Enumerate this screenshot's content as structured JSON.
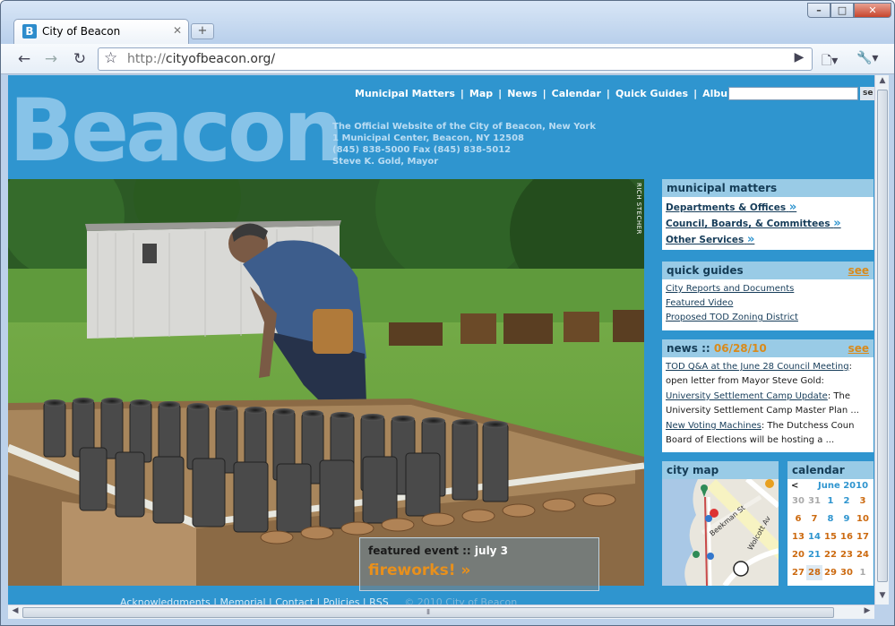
{
  "browser": {
    "tab_title": "City of Beacon",
    "tab_favicon": "B",
    "url_protocol": "http://",
    "url_host": "cityofbeacon.org/"
  },
  "site": {
    "nav": [
      "Municipal Matters",
      "Map",
      "News",
      "Calendar",
      "Quick Guides",
      "Albums"
    ],
    "search_button": "se",
    "logo": "Beacon",
    "tagline": [
      "The Official Website of the City of Beacon, New York",
      "1 Municipal Center, Beacon, NY 12508",
      "(845) 838-5000 Fax (845) 838-5012",
      "Steve K. Gold, Mayor"
    ],
    "photo_credit": "RICH STECHER"
  },
  "featured": {
    "label": "featured event ::",
    "date": "july 3",
    "event": "fireworks! »"
  },
  "municipal_matters": {
    "title": "municipal matters",
    "links": [
      "Departments & Offices",
      "Council, Boards, & Committees",
      "Other Services"
    ]
  },
  "quick_guides": {
    "title": "quick guides",
    "see": "see",
    "links": [
      "City Reports and Documents",
      "Featured Video",
      "Proposed TOD Zoning District"
    ]
  },
  "news": {
    "title": "news ::",
    "date": "06/28/10",
    "see": "see",
    "items": [
      {
        "link": "TOD Q&A at the June 28 Council Meeting",
        "text": ":",
        "more": "open letter from Mayor Steve Gold:"
      },
      {
        "link": "University Settlement Camp Update",
        "text": ": The",
        "more": "University Settlement Camp Master Plan ..."
      },
      {
        "link": "New Voting Machines",
        "text": ": The Dutchess Coun",
        "more": "Board of Elections will be hosting a ..."
      }
    ]
  },
  "city_map": {
    "title": "city map",
    "streets": [
      "Beekman St",
      "Wolcott Av"
    ]
  },
  "calendar": {
    "title": "calendar",
    "prev": "<",
    "month": "June 2010",
    "rows": [
      [
        "30",
        "31",
        "1",
        "2",
        "3"
      ],
      [
        "6",
        "7",
        "8",
        "9",
        "10"
      ],
      [
        "13",
        "14",
        "15",
        "16",
        "17"
      ],
      [
        "20",
        "21",
        "22",
        "23",
        "24"
      ],
      [
        "27",
        "28",
        "29",
        "30",
        "1"
      ]
    ]
  },
  "footer": {
    "links": [
      "Acknowledgments",
      "Memorial",
      "Contact",
      "Policies",
      "RSS"
    ],
    "copyright": "© 2010 City of Beacon"
  },
  "colors": {
    "page_blue": "#2f95cf",
    "panel_head": "#99cbe6",
    "accent_orange": "#d98a1a"
  }
}
